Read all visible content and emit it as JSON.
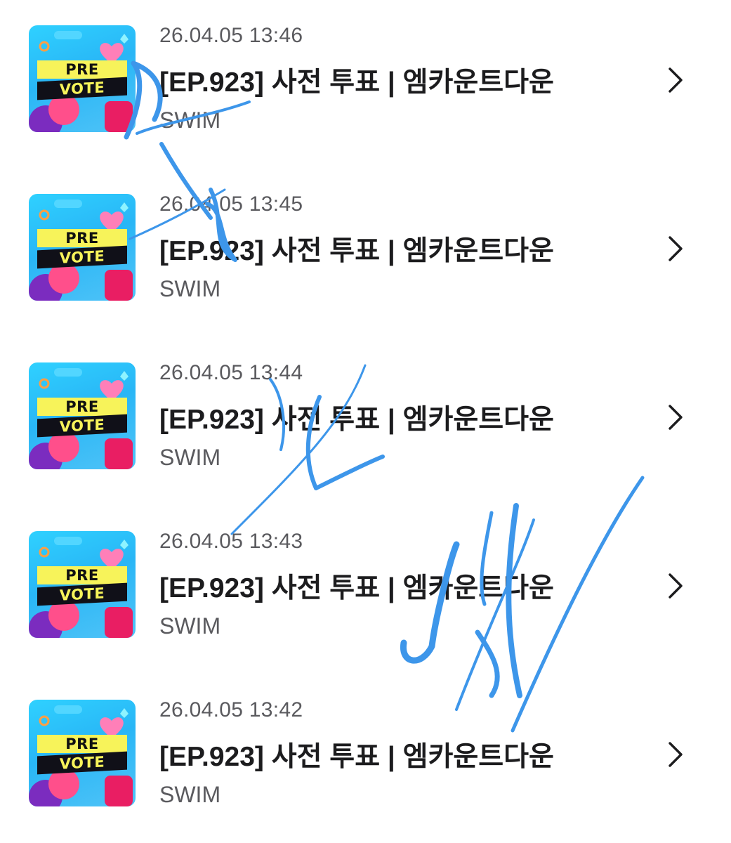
{
  "list": {
    "items": [
      {
        "thumbnail": {
          "line1": "PRE",
          "line2": "VOTE"
        },
        "timestamp": "26.04.05 13:46",
        "title": "[EP.923] 사전 투표 | 엠카운트다운",
        "source": "SWIM"
      },
      {
        "thumbnail": {
          "line1": "PRE",
          "line2": "VOTE"
        },
        "timestamp": "26.04.05 13:45",
        "title": "[EP.923] 사전 투표 | 엠카운트다운",
        "source": "SWIM"
      },
      {
        "thumbnail": {
          "line1": "PRE",
          "line2": "VOTE"
        },
        "timestamp": "26.04.05 13:44",
        "title": "[EP.923] 사전 투표 | 엠카운트다운",
        "source": "SWIM"
      },
      {
        "thumbnail": {
          "line1": "PRE",
          "line2": "VOTE"
        },
        "timestamp": "26.04.05 13:43",
        "title": "[EP.923] 사전 투표 | 엠카운트다운",
        "source": "SWIM"
      },
      {
        "thumbnail": {
          "line1": "PRE",
          "line2": "VOTE"
        },
        "timestamp": "26.04.05 13:42",
        "title": "[EP.923] 사전 투표 | 엠카운트다운",
        "source": "SWIM"
      }
    ]
  },
  "icons": {
    "row_action": "chevron-right-icon"
  },
  "colors": {
    "handwriting_overlay": "#3d96ea",
    "thumbnail_background": "#29b6f6",
    "thumbnail_yellow": "#f7f35a",
    "thumbnail_pink": "#ff4f8b"
  }
}
